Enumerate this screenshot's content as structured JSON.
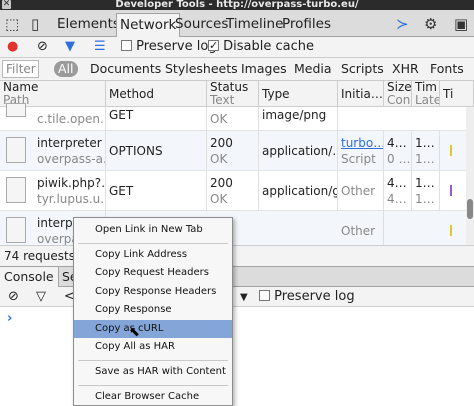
{
  "window": {
    "title": "Developer Tools - http://overpass-turbo.eu/",
    "close_icon": "close-icon"
  },
  "panels": {
    "tabs": [
      {
        "label": "Elements"
      },
      {
        "label": "Network",
        "active": true
      },
      {
        "label": "Sources"
      },
      {
        "label": "Timeline"
      },
      {
        "label": "Profiles"
      }
    ]
  },
  "network_toolbar": {
    "preserve_log": "Preserve log",
    "preserve_log_checked": false,
    "disable_cache": "Disable cache",
    "disable_cache_checked": true
  },
  "filter": {
    "placeholder": "Filter",
    "all": "All",
    "types": [
      "Documents",
      "Stylesheets",
      "Images",
      "Media",
      "Scripts",
      "XHR",
      "Fonts"
    ]
  },
  "columns": {
    "name": "Name",
    "name_sub": "Path",
    "method": "Method",
    "status": "Status",
    "status_sub": "Text",
    "type": "Type",
    "initiator": "Initia…",
    "size": "Size",
    "size_sub": "Con",
    "time": "Tim",
    "time_sub": "Late",
    "timeline": "Ti"
  },
  "rows": [
    {
      "name": "",
      "path": "c.tile.open…",
      "method": "GET",
      "status": "",
      "status_text": "OK",
      "type": "image/png",
      "initiator": "",
      "initiator_sub": "",
      "size": "",
      "size_sub": "",
      "time": "",
      "time_sub": ""
    },
    {
      "name": "interpreter",
      "path": "overpass-a…",
      "method": "OPTIONS",
      "status": "200",
      "status_text": "OK",
      "type": "application/…",
      "initiator": "turbo…",
      "initiator_sub": "Script",
      "size": "4…",
      "size_sub": "0 …",
      "time": "1…",
      "time_sub": "1…"
    },
    {
      "name": "piwik.php?…",
      "path": "tyr.lupus.u…",
      "method": "GET",
      "status": "200",
      "status_text": "OK",
      "type": "application/gif",
      "initiator": "",
      "initiator_sub": "Other",
      "size": "4…",
      "size_sub": "4…",
      "time": "1…",
      "time_sub": "1…"
    },
    {
      "name": "interpr",
      "path": "overpas",
      "method": "",
      "status": "",
      "status_text": "",
      "type": "",
      "initiator": "",
      "initiator_sub": "Other",
      "size": "",
      "size_sub": "",
      "time": "",
      "time_sub": ""
    }
  ],
  "summary": "74 requests",
  "drawer": {
    "tabs": [
      "Console",
      "Se"
    ],
    "preserve_log": "Preserve log"
  },
  "context_menu": {
    "items": [
      "Open Link in New Tab",
      "Copy Link Address",
      "Copy Request Headers",
      "Copy Response Headers",
      "Copy Response",
      "Copy as cURL",
      "Copy All as HAR",
      "Save as HAR with Content",
      "Clear Browser Cache"
    ],
    "highlighted": "Copy as cURL"
  },
  "colors": {
    "record": "#e0342c",
    "accent": "#2d6fe0",
    "highlight": "#84a5d7",
    "timeline_yellow": "#e2c82d",
    "timeline_purple": "#9a5ad8"
  }
}
